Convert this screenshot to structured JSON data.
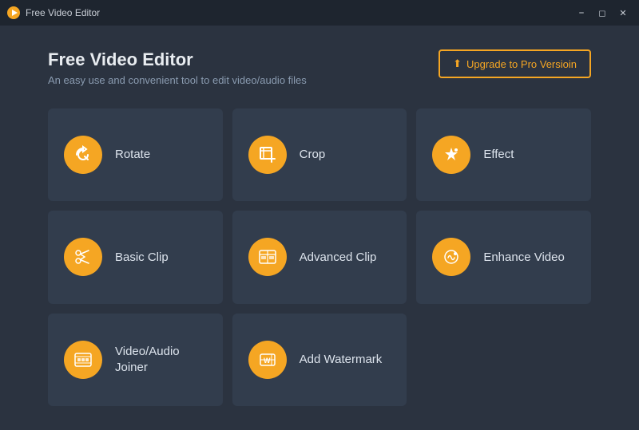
{
  "titleBar": {
    "appName": "Free Video Editor",
    "controls": [
      "minimize",
      "maximize",
      "close"
    ]
  },
  "header": {
    "title": "Free Video Editor",
    "subtitle": "An easy use and convenient tool to edit video/audio files",
    "upgradeButton": "Upgrade to Pro Versioin"
  },
  "tools": [
    {
      "id": "rotate",
      "label": "Rotate",
      "icon": "↺"
    },
    {
      "id": "crop",
      "label": "Crop",
      "icon": "⊡"
    },
    {
      "id": "effect",
      "label": "Effect",
      "icon": "★"
    },
    {
      "id": "basic-clip",
      "label": "Basic Clip",
      "icon": "✂"
    },
    {
      "id": "advanced-clip",
      "label": "Advanced Clip",
      "icon": "▦"
    },
    {
      "id": "enhance-video",
      "label": "Enhance\nVideo",
      "icon": "◉"
    },
    {
      "id": "video-audio-joiner",
      "label": "Video/Audio\nJoiner",
      "icon": "▣"
    },
    {
      "id": "add-watermark",
      "label": "Add\nWatermark",
      "icon": "⊞"
    }
  ]
}
